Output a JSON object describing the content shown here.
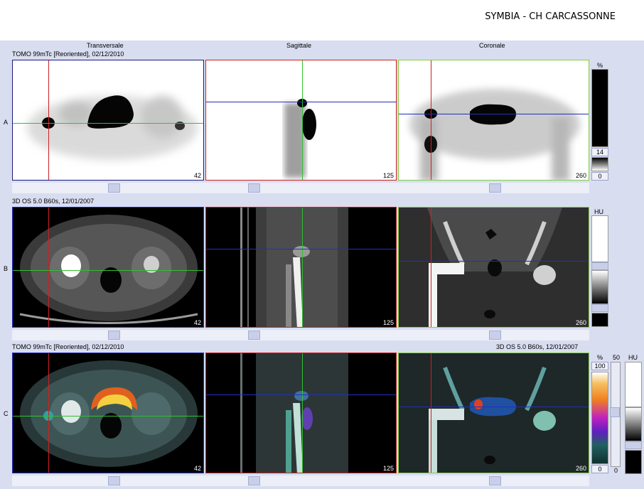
{
  "header": {
    "title": "SYMBIA - CH CARCASSONNE"
  },
  "columns": {
    "transversal": "Transversale",
    "sagittal": "Sagittale",
    "coronal": "Coronale"
  },
  "rows": {
    "A": {
      "label": "A",
      "series": "TOMO 99mTc [Reoriented], 02/12/2010",
      "slices": [
        "42",
        "125",
        "260"
      ],
      "unit": "%",
      "top_value": "14",
      "bottom_value": "0"
    },
    "B": {
      "label": "B",
      "series": "3D  OS  5.0  B60s, 12/01/2007",
      "slices": [
        "42",
        "125",
        "260"
      ],
      "unit": "HU"
    },
    "C": {
      "label": "C",
      "series_left": "TOMO 99mTc [Reoriented], 02/12/2010",
      "series_right": "3D  OS  5.0  B60s, 12/01/2007",
      "slices": [
        "42",
        "125",
        "260"
      ],
      "unit": "%",
      "unit2": "HU",
      "top_value": "100",
      "bottom_value": "0",
      "mid_value": "50",
      "mid_low": "0"
    }
  },
  "colors": {
    "red_cursor": "#d02020",
    "green_cursor": "#30c030",
    "blue_cursor": "#2030c0",
    "background": "#d9ddf0"
  }
}
